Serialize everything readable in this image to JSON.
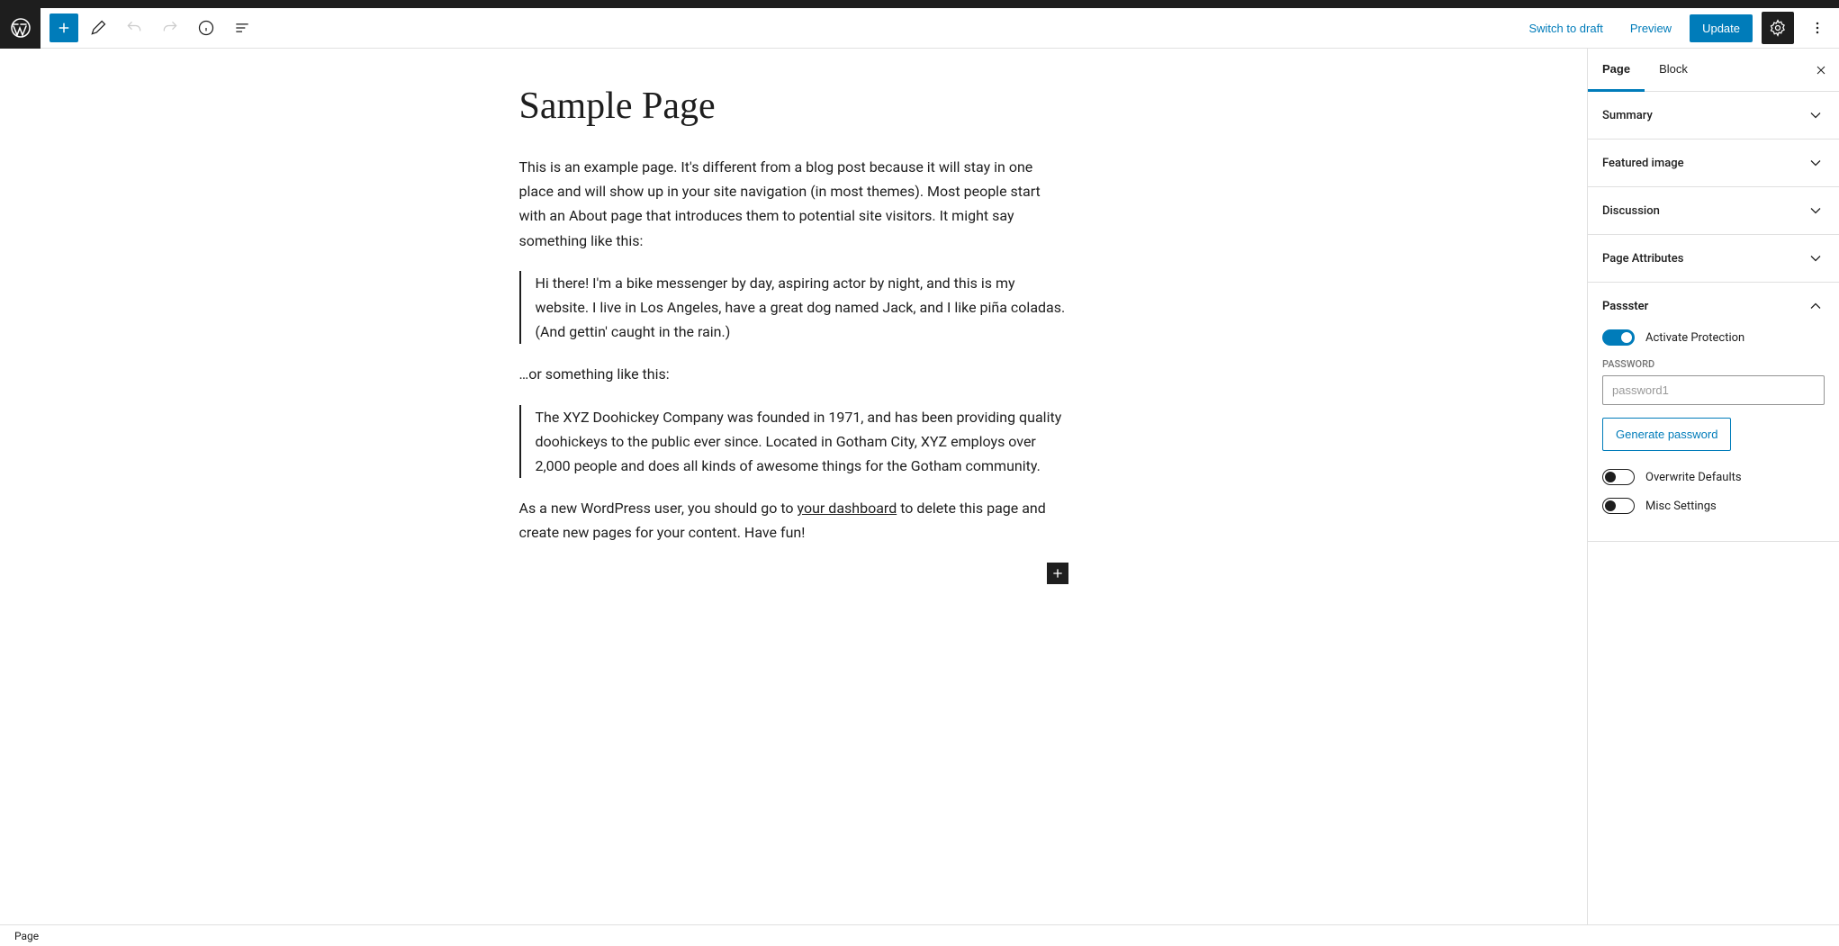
{
  "toolbar": {
    "switch_draft": "Switch to draft",
    "preview": "Preview",
    "update": "Update"
  },
  "editor": {
    "title": "Sample Page",
    "p1": "This is an example page. It's different from a blog post because it will stay in one place and will show up in your site navigation (in most themes). Most people start with an About page that introduces them to potential site visitors. It might say something like this:",
    "quote1": "Hi there! I'm a bike messenger by day, aspiring actor by night, and this is my website. I live in Los Angeles, have a great dog named Jack, and I like piña coladas. (And gettin' caught in the rain.)",
    "p2": "…or something like this:",
    "quote2": "The XYZ Doohickey Company was founded in 1971, and has been providing quality doohickeys to the public ever since. Located in Gotham City, XYZ employs over 2,000 people and does all kinds of awesome things for the Gotham community.",
    "p3_pre": "As a new WordPress user, you should go to ",
    "p3_link": "your dashboard",
    "p3_post": " to delete this page and create new pages for your content. Have fun!"
  },
  "sidebar": {
    "tabs": {
      "page": "Page",
      "block": "Block"
    },
    "panels": {
      "summary": "Summary",
      "featured_image": "Featured image",
      "discussion": "Discussion",
      "page_attributes": "Page Attributes",
      "passster": "Passster"
    },
    "passster": {
      "activate_label": "Activate Protection",
      "password_label": "PASSWORD",
      "password_placeholder": "password1",
      "generate_btn": "Generate password",
      "overwrite_label": "Overwrite Defaults",
      "misc_label": "Misc Settings"
    }
  },
  "footer": {
    "breadcrumb": "Page"
  }
}
